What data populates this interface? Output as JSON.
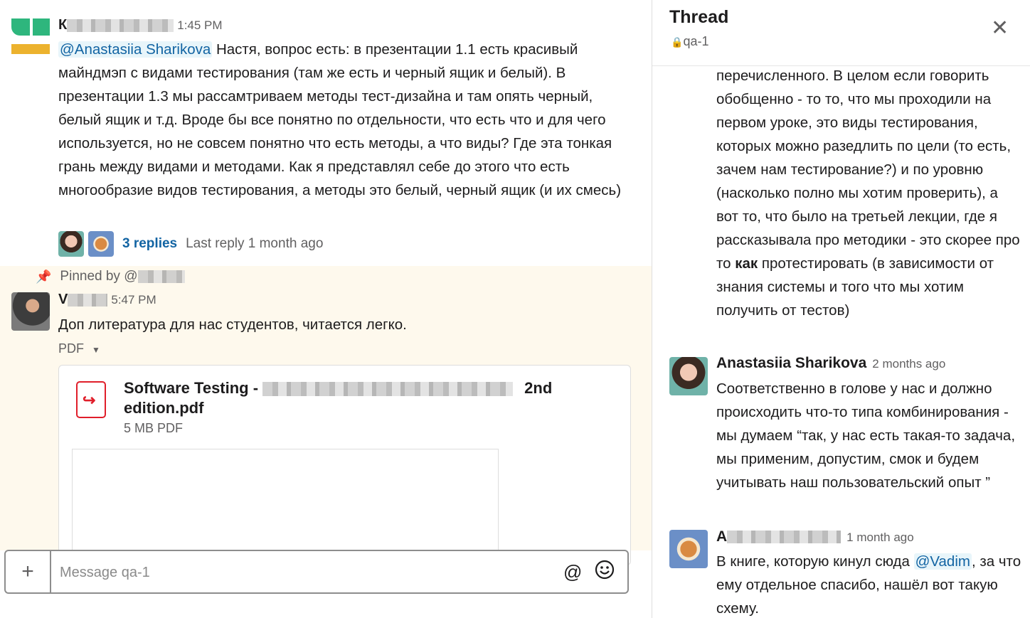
{
  "message1": {
    "author": "К",
    "time": "1:45 PM",
    "mention": "@Anastasiia Sharikova",
    "text": " Настя, вопрос есть: в презентации 1.1 есть красивый майндмэп с видами тестирования (там же есть и черный ящик и белый). В презентации 1.3 мы рассамтриваем методы тест-дизайна и там опять черный, белый ящик и т.д. Вроде бы все понятно по отдельности, что есть что и для чего используется, но не совсем понятно что есть методы, а что виды? Где эта тонкая грань между видами и методами. Как я представлял себе до этого что есть многообразие видов тестирования, а методы это белый, черный ящик (и их смесь)",
    "replies_label": "3 replies",
    "last_reply": "Last reply 1 month ago"
  },
  "pinned": {
    "label": "Pinned by @"
  },
  "message2": {
    "author": "V",
    "time": "5:47 PM",
    "text": "Доп литература для нас студентов, читается легко.",
    "file_type_label": "PDF",
    "file_title_start": "Software Testing - ",
    "file_title_end": "2nd edition.pdf",
    "file_meta": "5 MB PDF"
  },
  "composer": {
    "placeholder": "Message qa-1"
  },
  "thread": {
    "title": "Thread",
    "channel": "qa-1",
    "reply1_text_before": "перечисленного. В целом если говорить обобщенно - то то, что мы проходили на первом уроке, это виды тестирования, которых можно разедлить по цели (то есть, зачем нам тестирование?)  и по уровню (насколько полно мы хотим проверить), а вот то, что было на третьей лекции, где я рассказывала про методики - это скорее про то ",
    "reply1_bold": "как",
    "reply1_text_after": " протестировать (в зависимости от знания системы и того что мы хотим получить от тестов)",
    "reply2_author": "Anastasiia Sharikova",
    "reply2_ago": "2 months ago",
    "reply2_text": "Соответственно в голове у нас и должно происходить что-то типа комбинирования - мы думаем “так, у нас есть такая-то задача, мы применим, допустим, смок и будем учитывать наш пользовательский опыт ”",
    "reply3_author": "А",
    "reply3_ago": "1 month ago",
    "reply3_text_before": "В книге, которую кинул сюда ",
    "reply3_mention": "@Vadim",
    "reply3_text_after": ", за что ему отдельное спасибо, нашёл вот такую схему."
  },
  "colors": {
    "link": "#1264a3",
    "pinned_bg": "#fef9ed",
    "pdf_red": "#e01e2a",
    "pin_orange": "#e8912d"
  }
}
